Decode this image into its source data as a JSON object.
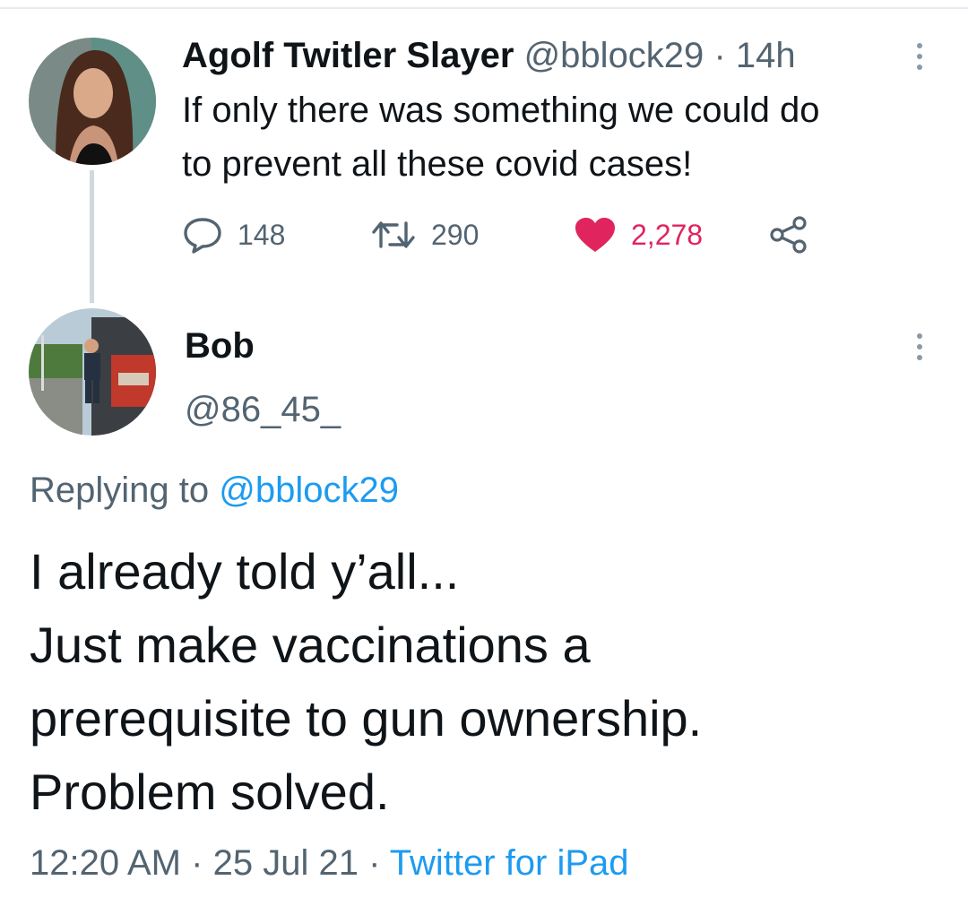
{
  "parent_tweet": {
    "display_name": "Agolf Twitler Slayer",
    "handle": "@bblock29",
    "separator": "·",
    "age": "14h",
    "text_lines": [
      "If only there was something we could do",
      "to prevent all these covid cases!"
    ],
    "reply_count": "148",
    "retweet_count": "290",
    "like_count": "2,278",
    "like_color": "#e0245e",
    "icons": [
      "reply-icon",
      "retweet-icon",
      "heart-icon",
      "share-icon",
      "more-icon"
    ]
  },
  "reply_tweet": {
    "display_name": "Bob",
    "handle": "@86_45_",
    "replying_prefix": "Replying to",
    "replying_handle": "@bblock29",
    "text_lines": [
      "I already told y’all...",
      "Just make vaccinations a",
      "prerequisite to gun ownership.",
      "Problem solved."
    ],
    "time": "12:20 AM",
    "date": "25 Jul 21",
    "separator": "·",
    "source": "Twitter for iPad"
  },
  "colors": {
    "link": "#1d9bf0",
    "secondary_text": "#536471",
    "primary_text": "#0f1419"
  }
}
